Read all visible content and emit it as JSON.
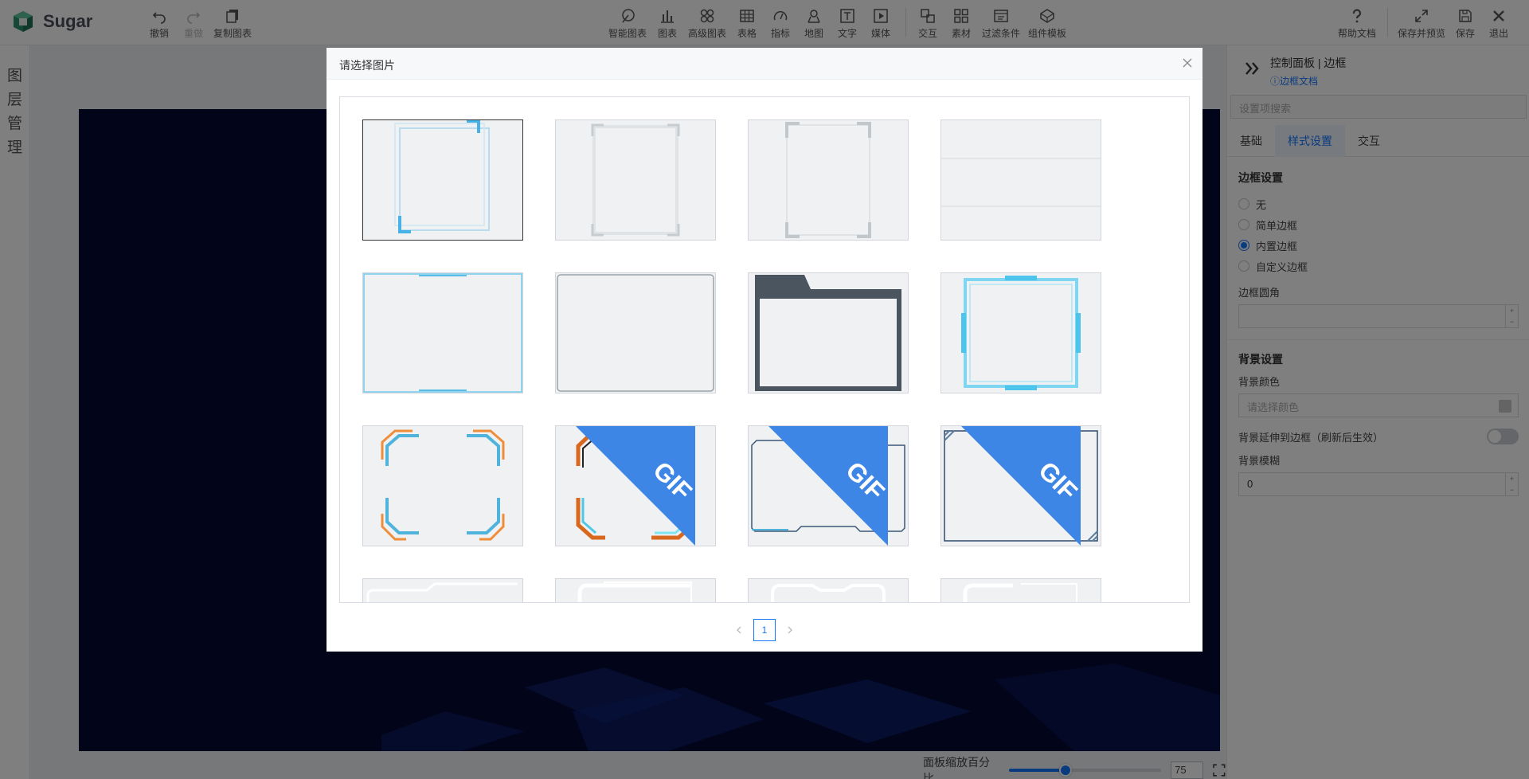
{
  "app": {
    "name": "Sugar"
  },
  "toolbar": {
    "left": [
      {
        "label": "撤销",
        "icon": "undo-icon"
      },
      {
        "label": "重做",
        "icon": "redo-icon"
      },
      {
        "label": "复制图表",
        "icon": "copy-icon"
      }
    ],
    "center": [
      {
        "label": "智能图表",
        "icon": "smart-chart-icon"
      },
      {
        "label": "图表",
        "icon": "bar-chart-icon"
      },
      {
        "label": "高级图表",
        "icon": "advanced-chart-icon"
      },
      {
        "label": "表格",
        "icon": "table-icon"
      },
      {
        "label": "指标",
        "icon": "gauge-icon"
      },
      {
        "label": "地图",
        "icon": "map-pin-icon"
      },
      {
        "label": "文字",
        "icon": "text-icon"
      },
      {
        "label": "媒体",
        "icon": "media-icon"
      },
      {
        "label": "交互",
        "icon": "interaction-icon"
      },
      {
        "label": "素材",
        "icon": "assets-icon"
      },
      {
        "label": "过滤条件",
        "icon": "filter-icon"
      },
      {
        "label": "组件模板",
        "icon": "template-icon"
      }
    ],
    "right": [
      {
        "label": "帮助文档",
        "icon": "help-icon"
      },
      {
        "label": "保存并预览",
        "icon": "preview-icon"
      },
      {
        "label": "保存",
        "icon": "save-icon"
      },
      {
        "label": "退出",
        "icon": "close-icon"
      }
    ]
  },
  "layers": {
    "label": "图层管理"
  },
  "canvas": {
    "zoom_label": "面板缩放百分比",
    "zoom_value": "75",
    "zoom_fraction": 0.37
  },
  "right_panel": {
    "title": "控制面板 | 边框",
    "doc_link": "边框文档",
    "search_placeholder": "设置项搜索",
    "tabs": [
      "基础",
      "样式设置",
      "交互"
    ],
    "active_tab": 1,
    "border_section": "边框设置",
    "border_options": [
      "无",
      "简单边框",
      "内置边框",
      "自定义边框"
    ],
    "border_selected": 2,
    "radius_label": "边框圆角",
    "radius_value": "",
    "bg_section": "背景设置",
    "bg_color_label": "背景颜色",
    "bg_color_placeholder": "请选择颜色",
    "bg_extend_label": "背景延伸到边框（刷新后生效）",
    "bg_blur_label": "背景模糊",
    "bg_blur_value": "0"
  },
  "modal": {
    "title": "请选择图片",
    "gif_badge": "GIF",
    "page": "1"
  },
  "colors": {
    "accent": "#1677ff",
    "artboard": "#050a35",
    "gif_badge": "#3d86e6"
  }
}
